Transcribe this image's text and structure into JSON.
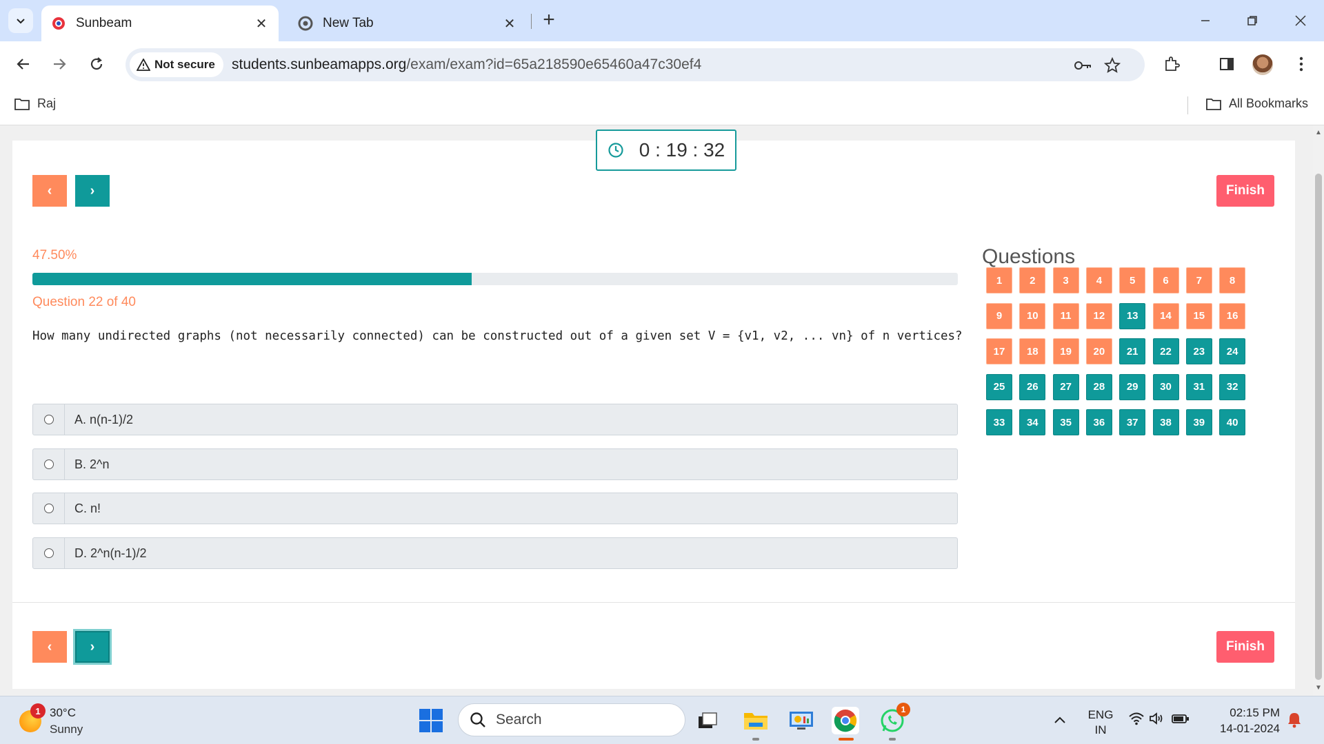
{
  "browser": {
    "tabs": [
      {
        "title": "Sunbeam",
        "active": true
      },
      {
        "title": "New Tab",
        "active": false
      }
    ],
    "security_label": "Not secure",
    "url_host": "students.sunbeamapps.org",
    "url_path": "/exam/exam?id=65a218590e65460a47c30ef4",
    "bookmarks": {
      "folder": "Raj",
      "all": "All Bookmarks"
    }
  },
  "exam": {
    "timer": "0 : 19 : 32",
    "prev_symbol": "‹",
    "next_symbol": "›",
    "finish_label": "Finish",
    "progress_text": "47.50%",
    "progress_value": 47.5,
    "question_counter": "Question 22 of 40",
    "question_text": "How many undirected graphs (not necessarily connected) can be constructed out of a given set V = {v1, v2, ... vn} of n vertices?",
    "options": [
      {
        "label": "A. n(n-1)/2"
      },
      {
        "label": "B. 2^n"
      },
      {
        "label": "C. n!"
      },
      {
        "label": "D. 2^n(n-1)/2"
      }
    ],
    "questions_title": "Questions",
    "question_numbers": [
      {
        "n": "1",
        "status": "unanswered"
      },
      {
        "n": "2",
        "status": "unanswered"
      },
      {
        "n": "3",
        "status": "unanswered"
      },
      {
        "n": "4",
        "status": "unanswered"
      },
      {
        "n": "5",
        "status": "unanswered"
      },
      {
        "n": "6",
        "status": "unanswered"
      },
      {
        "n": "7",
        "status": "unanswered"
      },
      {
        "n": "8",
        "status": "unanswered"
      },
      {
        "n": "9",
        "status": "unanswered"
      },
      {
        "n": "10",
        "status": "unanswered"
      },
      {
        "n": "11",
        "status": "unanswered"
      },
      {
        "n": "12",
        "status": "unanswered"
      },
      {
        "n": "13",
        "status": "answered"
      },
      {
        "n": "14",
        "status": "unanswered"
      },
      {
        "n": "15",
        "status": "unanswered"
      },
      {
        "n": "16",
        "status": "unanswered"
      },
      {
        "n": "17",
        "status": "unanswered"
      },
      {
        "n": "18",
        "status": "unanswered"
      },
      {
        "n": "19",
        "status": "unanswered"
      },
      {
        "n": "20",
        "status": "unanswered"
      },
      {
        "n": "21",
        "status": "answered"
      },
      {
        "n": "22",
        "status": "answered"
      },
      {
        "n": "23",
        "status": "answered"
      },
      {
        "n": "24",
        "status": "answered"
      },
      {
        "n": "25",
        "status": "answered"
      },
      {
        "n": "26",
        "status": "answered"
      },
      {
        "n": "27",
        "status": "answered"
      },
      {
        "n": "28",
        "status": "answered"
      },
      {
        "n": "29",
        "status": "answered"
      },
      {
        "n": "30",
        "status": "answered"
      },
      {
        "n": "31",
        "status": "answered"
      },
      {
        "n": "32",
        "status": "answered"
      },
      {
        "n": "33",
        "status": "answered"
      },
      {
        "n": "34",
        "status": "answered"
      },
      {
        "n": "35",
        "status": "answered"
      },
      {
        "n": "36",
        "status": "answered"
      },
      {
        "n": "37",
        "status": "answered"
      },
      {
        "n": "38",
        "status": "answered"
      },
      {
        "n": "39",
        "status": "answered"
      },
      {
        "n": "40",
        "status": "answered"
      }
    ]
  },
  "taskbar": {
    "weather_temp": "30°C",
    "weather_cond": "Sunny",
    "weather_badge": "1",
    "search_placeholder": "Search",
    "whatsapp_badge": "1",
    "lang_top": "ENG",
    "lang_bottom": "IN",
    "time": "02:15 PM",
    "date": "14-01-2024"
  },
  "colors": {
    "accent_teal": "#0f9a9a",
    "accent_orange": "#ff8a5c",
    "finish_red": "#ff5e6f"
  }
}
